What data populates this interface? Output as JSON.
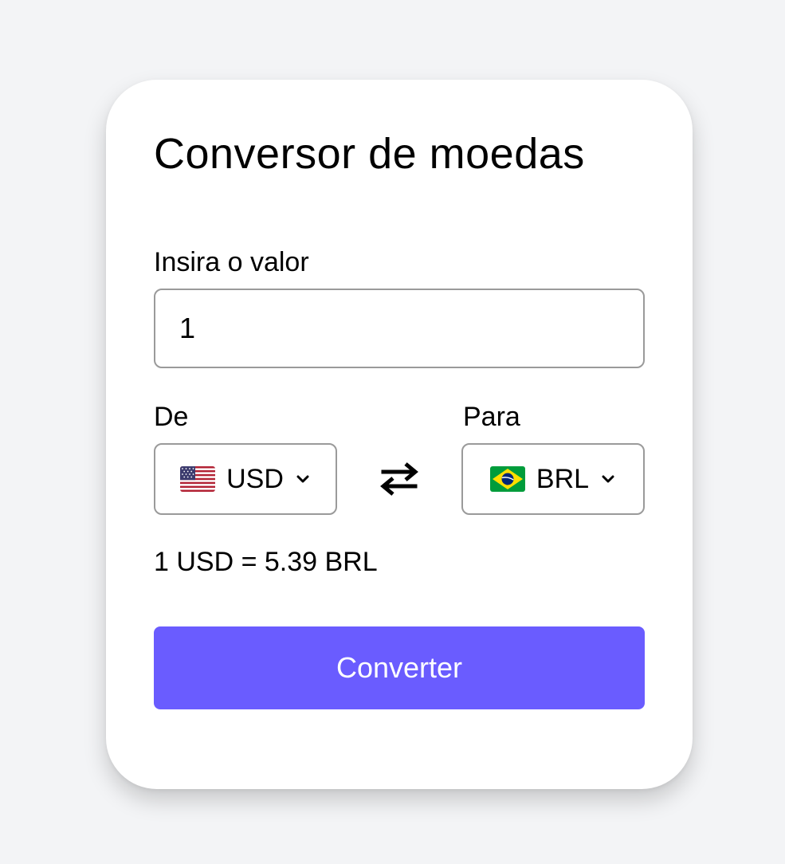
{
  "card": {
    "title": "Conversor de moedas",
    "amount": {
      "label": "Insira o valor",
      "value": "1"
    },
    "from": {
      "label": "De",
      "currency": "USD",
      "flag_icon": "us-flag-icon"
    },
    "to": {
      "label": "Para",
      "currency": "BRL",
      "flag_icon": "brazil-flag-icon"
    },
    "swap_icon": "swap-arrows-icon",
    "rate_text": "1 USD = 5.39 BRL",
    "convert_label": "Converter"
  },
  "colors": {
    "accent": "#6a5cff",
    "background": "#f3f4f6",
    "card": "#ffffff",
    "border": "#9a9a9a"
  }
}
